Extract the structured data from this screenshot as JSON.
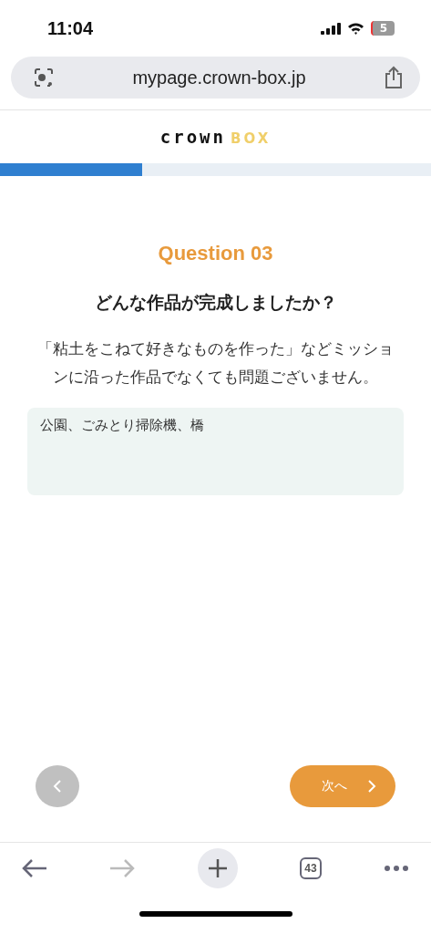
{
  "status_bar": {
    "time": "11:04",
    "battery": "5"
  },
  "address_bar": {
    "url": "mypage.crown-box.jp"
  },
  "logo": {
    "word": "crown",
    "accent": "BOX"
  },
  "progress": {
    "level": 0.33
  },
  "question": {
    "number": "Question 03",
    "title": "どんな作品が完成しましたか？",
    "description": "「粘土をこねて好きなものを作った」などミッションに沿った作品でなくても問題ございません。",
    "answer": "公園、ごみとり掃除機、橋"
  },
  "nav": {
    "back_disabled": true,
    "next": "次へ"
  },
  "toolbar": {
    "tab_count": "43"
  }
}
